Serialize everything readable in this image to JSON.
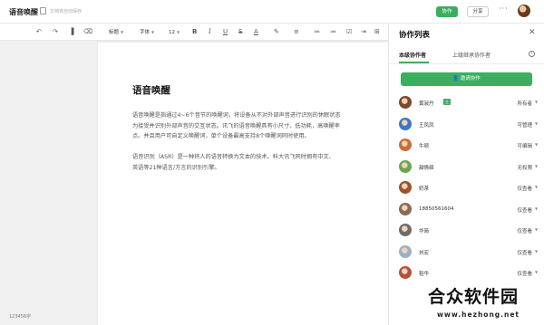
{
  "header": {
    "doc_name": "语音唤醒",
    "status": "文档将自动保存",
    "collab_label": "协作",
    "share_label": "分享",
    "more": "···"
  },
  "toolbar": {
    "undo": "↶",
    "redo": "↷",
    "format_painter": "▐",
    "clear_format": "⌫",
    "heading_label": "标题",
    "font_label": "字体",
    "size_label": "12",
    "bold": "B",
    "italic": "I",
    "underline": "U",
    "strike": "S",
    "font_color": "A",
    "highlight": "✎",
    "align": "≡",
    "list_bullet": "≔",
    "list_ordered": "≔",
    "checklist": "☑",
    "indent": "⇥",
    "table": "⊞",
    "image": "▣",
    "attachment": "⎘",
    "link": "∞",
    "code": "{ }",
    "caret": "▼"
  },
  "document": {
    "title": "语音唤醒",
    "paragraph1_line1": "语音唤醒是指通过4~6个音节的唤醒词，将设备从不对外部声音进行识别的休眠状态",
    "paragraph1_line2": "为接受并识别外部声音的交互状态。讯飞的语音唤醒具有小尺寸，低功耗，高唤醒率",
    "paragraph1_line3": "点。并且用户可自定义唤醒词，单个设备最高支持8个唤醒词同时使用。",
    "paragraph2_line1": "语音识别（ASR）是一种将人的语音转换为文本的技术。科大讯飞同时拥有中文、",
    "paragraph2_line2": "英语等21种语言/方言的识别引擎。"
  },
  "footer": {
    "word_count": "123456字"
  },
  "panel": {
    "title": "协作列表",
    "close": "✕",
    "tab_level": "本级协作者",
    "tab_parent": "上级继承协作者",
    "info": "i",
    "invite_label": "邀请协作",
    "owner_badge": "主",
    "collaborators": [
      {
        "name": "黄淑丹",
        "permission": "所有者",
        "color": "#7a4a2a"
      },
      {
        "name": "王凤凤",
        "permission": "可管理",
        "color": "#3b78c9"
      },
      {
        "name": "牛顿",
        "permission": "可编辑",
        "color": "#c96e3b"
      },
      {
        "name": "甜情绵",
        "permission": "无权限",
        "color": "#6aa84f"
      },
      {
        "name": "奶茶",
        "permission": "仅查看",
        "color": "#a0522d"
      },
      {
        "name": "18850561604",
        "permission": "仅查看",
        "color": "#8a6a52"
      },
      {
        "name": "华简",
        "permission": "仅查看",
        "color": "#6d6d6d"
      },
      {
        "name": "刘宏",
        "permission": "仅查看",
        "color": "#9ab0c8"
      },
      {
        "name": "稻华",
        "permission": "仅查看",
        "color": "#b5533c"
      }
    ]
  },
  "watermark": {
    "text": "合众软件园",
    "url": "www.hezhong.net"
  },
  "colors": {
    "accent": "#3cae60"
  }
}
